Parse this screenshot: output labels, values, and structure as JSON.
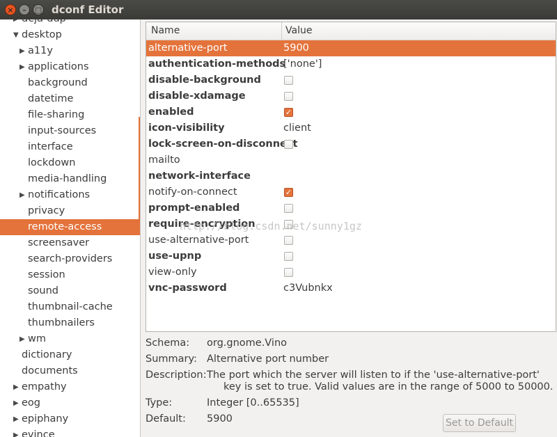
{
  "window": {
    "title": "dconf Editor",
    "close": "×",
    "minimize": "–",
    "maximize": "□"
  },
  "sidebar": {
    "items": [
      {
        "label": "deja-dup",
        "expander": "▶",
        "depth": 1
      },
      {
        "label": "desktop",
        "expander": "▼",
        "depth": 1
      },
      {
        "label": "a11y",
        "expander": "▶",
        "depth": 2
      },
      {
        "label": "applications",
        "expander": "▶",
        "depth": 2
      },
      {
        "label": "background",
        "expander": "",
        "depth": 2
      },
      {
        "label": "datetime",
        "expander": "",
        "depth": 2
      },
      {
        "label": "file-sharing",
        "expander": "",
        "depth": 2
      },
      {
        "label": "input-sources",
        "expander": "",
        "depth": 2
      },
      {
        "label": "interface",
        "expander": "",
        "depth": 2
      },
      {
        "label": "lockdown",
        "expander": "",
        "depth": 2
      },
      {
        "label": "media-handling",
        "expander": "",
        "depth": 2
      },
      {
        "label": "notifications",
        "expander": "▶",
        "depth": 2
      },
      {
        "label": "privacy",
        "expander": "",
        "depth": 2
      },
      {
        "label": "remote-access",
        "expander": "",
        "depth": 2,
        "selected": true
      },
      {
        "label": "screensaver",
        "expander": "",
        "depth": 2
      },
      {
        "label": "search-providers",
        "expander": "",
        "depth": 2
      },
      {
        "label": "session",
        "expander": "",
        "depth": 2
      },
      {
        "label": "sound",
        "expander": "",
        "depth": 2
      },
      {
        "label": "thumbnail-cache",
        "expander": "",
        "depth": 2
      },
      {
        "label": "thumbnailers",
        "expander": "",
        "depth": 2
      },
      {
        "label": "wm",
        "expander": "▶",
        "depth": 2
      },
      {
        "label": "dictionary",
        "expander": "",
        "depth": 1
      },
      {
        "label": "documents",
        "expander": "",
        "depth": 1
      },
      {
        "label": "empathy",
        "expander": "▶",
        "depth": 1
      },
      {
        "label": "eog",
        "expander": "▶",
        "depth": 1
      },
      {
        "label": "epiphany",
        "expander": "▶",
        "depth": 1
      },
      {
        "label": "evince",
        "expander": "▶",
        "depth": 1
      }
    ]
  },
  "table": {
    "headers": {
      "name": "Name",
      "value": "Value"
    },
    "rows": [
      {
        "name": "alternative-port",
        "value": "5900",
        "kind": "text",
        "bold": false,
        "selected": true
      },
      {
        "name": "authentication-methods",
        "value": "['none']",
        "kind": "text",
        "bold": true
      },
      {
        "name": "disable-background",
        "value": "",
        "kind": "checkbox",
        "checked": false,
        "bold": true
      },
      {
        "name": "disable-xdamage",
        "value": "",
        "kind": "checkbox",
        "checked": false,
        "bold": true
      },
      {
        "name": "enabled",
        "value": "",
        "kind": "checkbox",
        "checked": true,
        "bold": true
      },
      {
        "name": "icon-visibility",
        "value": "client",
        "kind": "text",
        "bold": true
      },
      {
        "name": "lock-screen-on-disconnect",
        "value": "",
        "kind": "checkbox",
        "checked": false,
        "bold": true
      },
      {
        "name": "mailto",
        "value": "",
        "kind": "text",
        "bold": false
      },
      {
        "name": "network-interface",
        "value": "",
        "kind": "text",
        "bold": true
      },
      {
        "name": "notify-on-connect",
        "value": "",
        "kind": "checkbox",
        "checked": true,
        "bold": false
      },
      {
        "name": "prompt-enabled",
        "value": "",
        "kind": "checkbox",
        "checked": false,
        "bold": true
      },
      {
        "name": "require-encryption",
        "value": "",
        "kind": "checkbox",
        "checked": false,
        "bold": true
      },
      {
        "name": "use-alternative-port",
        "value": "",
        "kind": "checkbox",
        "checked": false,
        "bold": false
      },
      {
        "name": "use-upnp",
        "value": "",
        "kind": "checkbox",
        "checked": false,
        "bold": true
      },
      {
        "name": "view-only",
        "value": "",
        "kind": "checkbox",
        "checked": false,
        "bold": false
      },
      {
        "name": "vnc-password",
        "value": "c3Vubnkx",
        "kind": "text",
        "bold": true
      }
    ]
  },
  "details": {
    "schema_label": "Schema:",
    "schema": "org.gnome.Vino",
    "summary_label": "Summary:",
    "summary": "Alternative port number",
    "description_label": "Description:",
    "description_line1": "The port which the server will listen to if the 'use-alternative-port'",
    "description_line2": "key is set to true. Valid values are in the range of 5000 to 50000.",
    "type_label": "Type:",
    "type": "Integer [0..65535]",
    "default_label": "Default:",
    "default": "5900",
    "set_default_button": "Set to Default"
  },
  "watermark": "http://blog.csdn.net/sunny1gz",
  "colors": {
    "accent": "#e4733b",
    "titlebar": "#3c3b37"
  }
}
